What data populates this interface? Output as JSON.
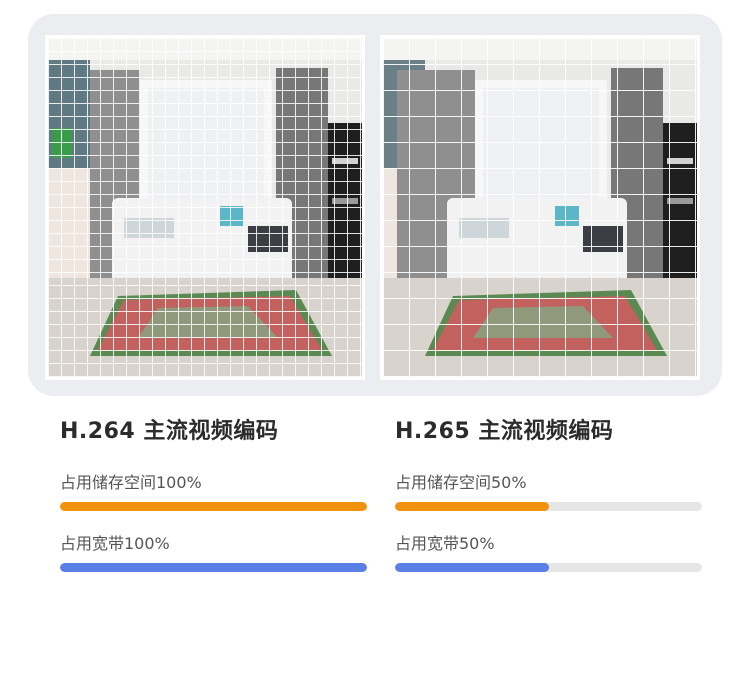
{
  "colors": {
    "storage_bar": "#f0920d",
    "bandwidth_bar": "#5a80e6",
    "track": "#e6e6e6",
    "card": "#ebedf1"
  },
  "comparison": [
    {
      "codec_title": "H.264 主流视频编码",
      "storage_label": "占用储存空间100%",
      "storage_fraction": 1.0,
      "bandwidth_label": "占用宽带100%",
      "bandwidth_fraction": 1.0
    },
    {
      "codec_title": "H.265 主流视频编码",
      "storage_label": "占用储存空间50%",
      "storage_fraction": 0.5,
      "bandwidth_label": "占用宽带50%",
      "bandwidth_fraction": 0.5
    }
  ]
}
